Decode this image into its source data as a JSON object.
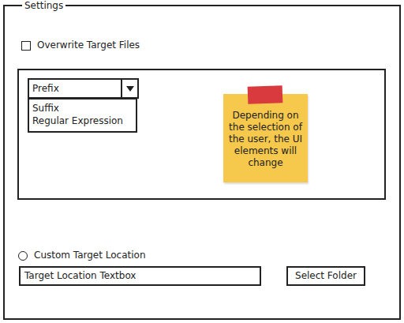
{
  "window": {
    "title": "Settings"
  },
  "overwrite": {
    "label": "Overwrite Target Files",
    "checked": false
  },
  "dropdown": {
    "value": "Prefix",
    "expanded": true,
    "options": [
      {
        "label": "Suffix",
        "selected": false
      },
      {
        "label": "Regular Expression",
        "selected": false
      }
    ]
  },
  "note": {
    "text": "Depending on the selection of the user, the UI elements will change"
  },
  "custom_location": {
    "label": "Custom Target Location",
    "selected": false
  },
  "target_field": {
    "value": "Target Location Textbox"
  },
  "buttons": [
    "Select Folder"
  ]
}
